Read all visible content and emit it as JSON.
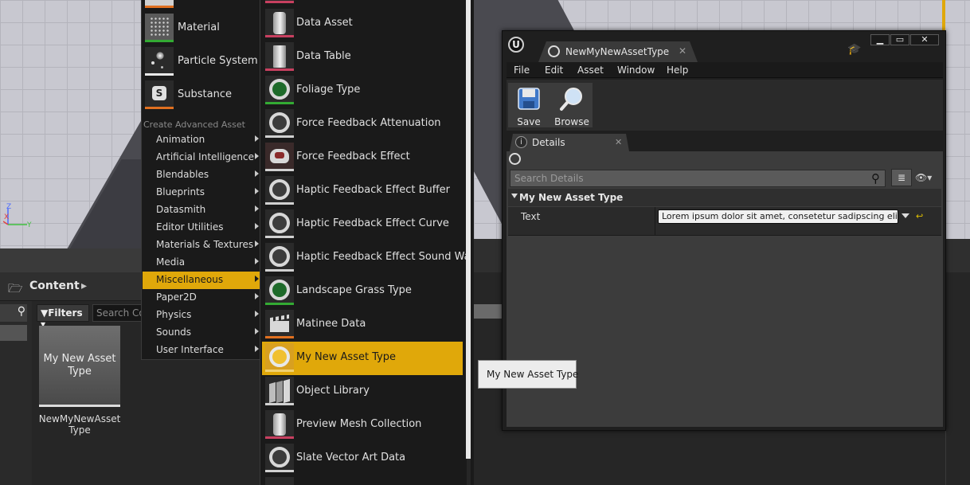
{
  "left_viewport": {
    "axes": {
      "z": "Z",
      "x": "X",
      "y": "Y"
    }
  },
  "content_browser": {
    "title": "Content",
    "filters_label": "Filters",
    "search_placeholder": "Search Co",
    "asset_tile": {
      "thumbnail_text": "My New Asset Type",
      "name": "NewMyNewAsset Type"
    }
  },
  "menu_basic": {
    "items": [
      {
        "label": "Material",
        "icon": "material-icon"
      },
      {
        "label": "Particle System",
        "icon": "particle-system-icon"
      },
      {
        "label": "Substance",
        "icon": "substance-icon"
      }
    ]
  },
  "menu_advanced": {
    "section_title": "Create Advanced Asset",
    "items": [
      {
        "label": "Animation"
      },
      {
        "label": "Artificial Intelligence"
      },
      {
        "label": "Blendables"
      },
      {
        "label": "Blueprints"
      },
      {
        "label": "Datasmith"
      },
      {
        "label": "Editor Utilities"
      },
      {
        "label": "Materials & Textures"
      },
      {
        "label": "Media"
      },
      {
        "label": "Miscellaneous"
      },
      {
        "label": "Paper2D"
      },
      {
        "label": "Physics"
      },
      {
        "label": "Sounds"
      },
      {
        "label": "User Interface"
      }
    ],
    "selected": "Miscellaneous"
  },
  "misc_submenu": {
    "items": [
      {
        "label": "Data Asset",
        "icon": "data-asset-icon"
      },
      {
        "label": "Data Table",
        "icon": "data-table-icon"
      },
      {
        "label": "Foliage Type",
        "icon": "foliage-type-icon"
      },
      {
        "label": "Force Feedback Attenuation",
        "icon": "force-feedback-attenuation-icon"
      },
      {
        "label": "Force Feedback Effect",
        "icon": "force-feedback-effect-icon"
      },
      {
        "label": "Haptic Feedback Effect Buffer",
        "icon": "haptic-buffer-icon"
      },
      {
        "label": "Haptic Feedback Effect Curve",
        "icon": "haptic-curve-icon"
      },
      {
        "label": "Haptic Feedback Effect Sound Wave",
        "icon": "haptic-sound-wave-icon"
      },
      {
        "label": "Landscape Grass Type",
        "icon": "landscape-grass-icon"
      },
      {
        "label": "Matinee Data",
        "icon": "matinee-data-icon"
      },
      {
        "label": "My New Asset Type",
        "icon": "my-new-asset-type-icon"
      },
      {
        "label": "Object Library",
        "icon": "object-library-icon"
      },
      {
        "label": "Preview Mesh Collection",
        "icon": "preview-mesh-collection-icon"
      },
      {
        "label": "Slate Vector Art Data",
        "icon": "slate-vector-art-icon"
      }
    ],
    "highlighted": "My New Asset Type"
  },
  "tooltip": {
    "text": "My New Asset Type"
  },
  "editor": {
    "tab_title": "NewMyNewAssetType",
    "menu": [
      "File",
      "Edit",
      "Asset",
      "Window",
      "Help"
    ],
    "toolbar": {
      "save_label": "Save",
      "browse_label": "Browse"
    },
    "details": {
      "tab_label": "Details",
      "search_placeholder": "Search Details",
      "category": "My New Asset Type",
      "property": {
        "name": "Text",
        "value": "Lorem ipsum dolor sit amet, consetetur sadipscing elitr, s"
      }
    },
    "window_controls": {
      "minimize": "▁",
      "maximize": "▭",
      "close": "✕"
    }
  },
  "colors": {
    "accent": "#e0a80a",
    "menu_bg": "#1a1a1a",
    "panel_bg": "#3c3c3c",
    "material_icon_bar": "#33aa33",
    "substance_icon_bar": "#e07020"
  }
}
